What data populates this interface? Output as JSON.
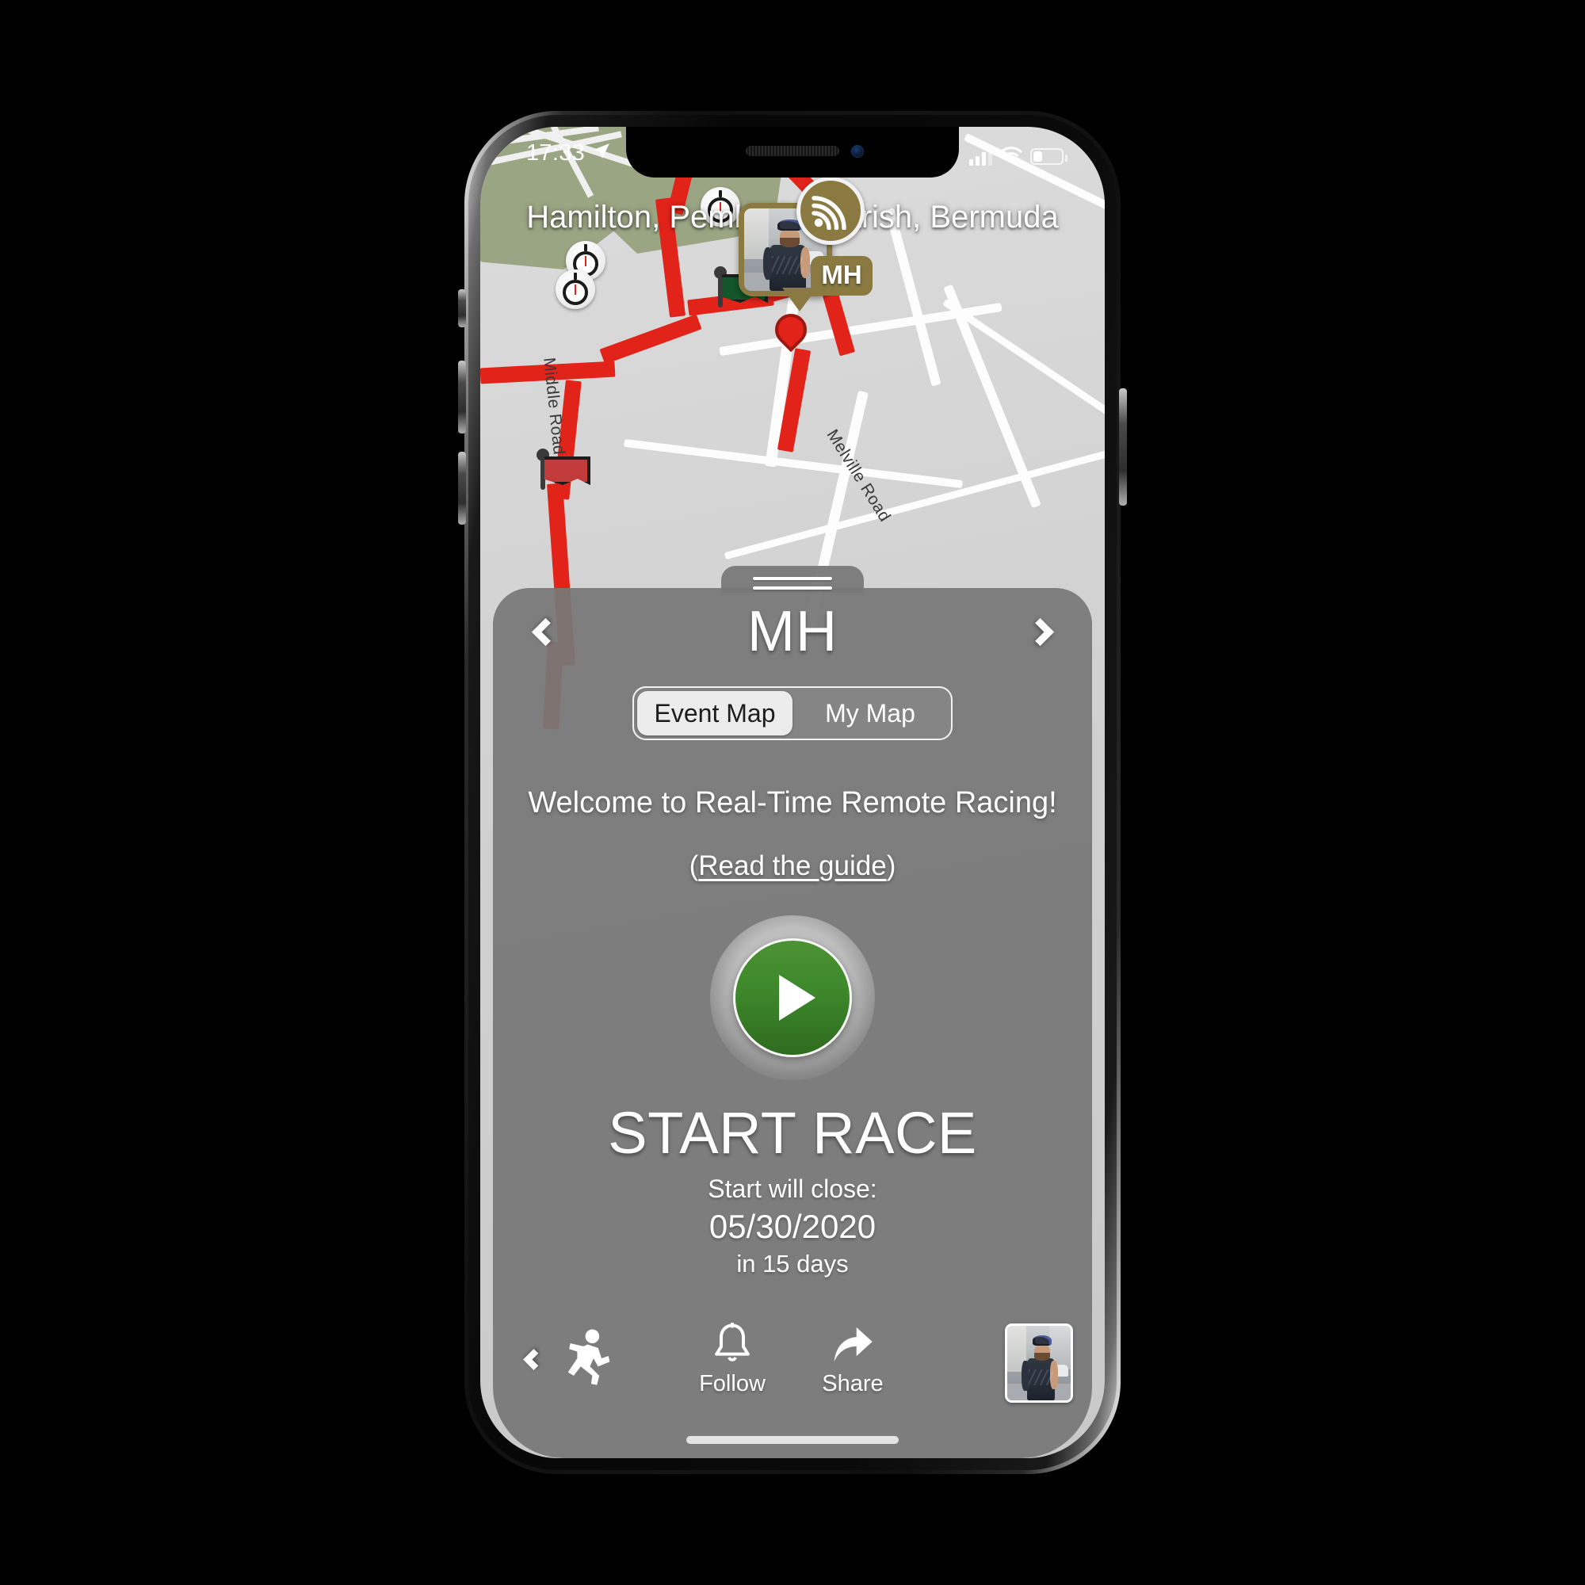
{
  "status_bar": {
    "time": "17:33",
    "location_arrow_icon": "location-arrow-icon",
    "cellular_icon": "cellular-signal-icon",
    "wifi_icon": "wifi-icon",
    "battery_icon": "battery-icon"
  },
  "map": {
    "place_title": "Hamilton, Pembroke Parish, Bermuda",
    "road_labels": [
      {
        "name": "Middle Road"
      },
      {
        "name": "Melville Road"
      }
    ],
    "markers": {
      "rider_initials": "MH",
      "live_icon": "broadcast-signal-icon",
      "start_flag_icon": "green-flag-icon",
      "finish_flag_icon": "red-flag-icon",
      "checkpoint_icon": "stopwatch-icon",
      "checkpoint_count": 4
    },
    "route_color": "#e2231a",
    "land_color": "#9aa583"
  },
  "sheet": {
    "title": "MH",
    "prev_icon": "chevron-left-icon",
    "next_icon": "chevron-right-icon",
    "grabber_icon": "drag-handle-icon",
    "segments": [
      {
        "label": "Event Map",
        "selected": true
      },
      {
        "label": "My Map",
        "selected": false
      }
    ],
    "welcome_text": "Welcome to Real-Time Remote Racing!",
    "guide_open_paren": "(",
    "guide_link": "Read the guide",
    "guide_close_paren": ")",
    "play_icon": "play-icon",
    "play_button_color": "#3f8a2c",
    "start_race_label": "START RACE",
    "close_label": "Start will close:",
    "close_date": "05/30/2020",
    "close_relative": "in 15 days"
  },
  "toolbar": {
    "back_icon": "chevron-left-icon",
    "activity_icon": "runner-icon",
    "items": [
      {
        "label": "Follow",
        "icon": "bell-icon"
      },
      {
        "label": "Share",
        "icon": "share-arrow-icon"
      }
    ],
    "avatar_icon": "avatar-thumbnail",
    "home_indicator": "home-indicator"
  }
}
